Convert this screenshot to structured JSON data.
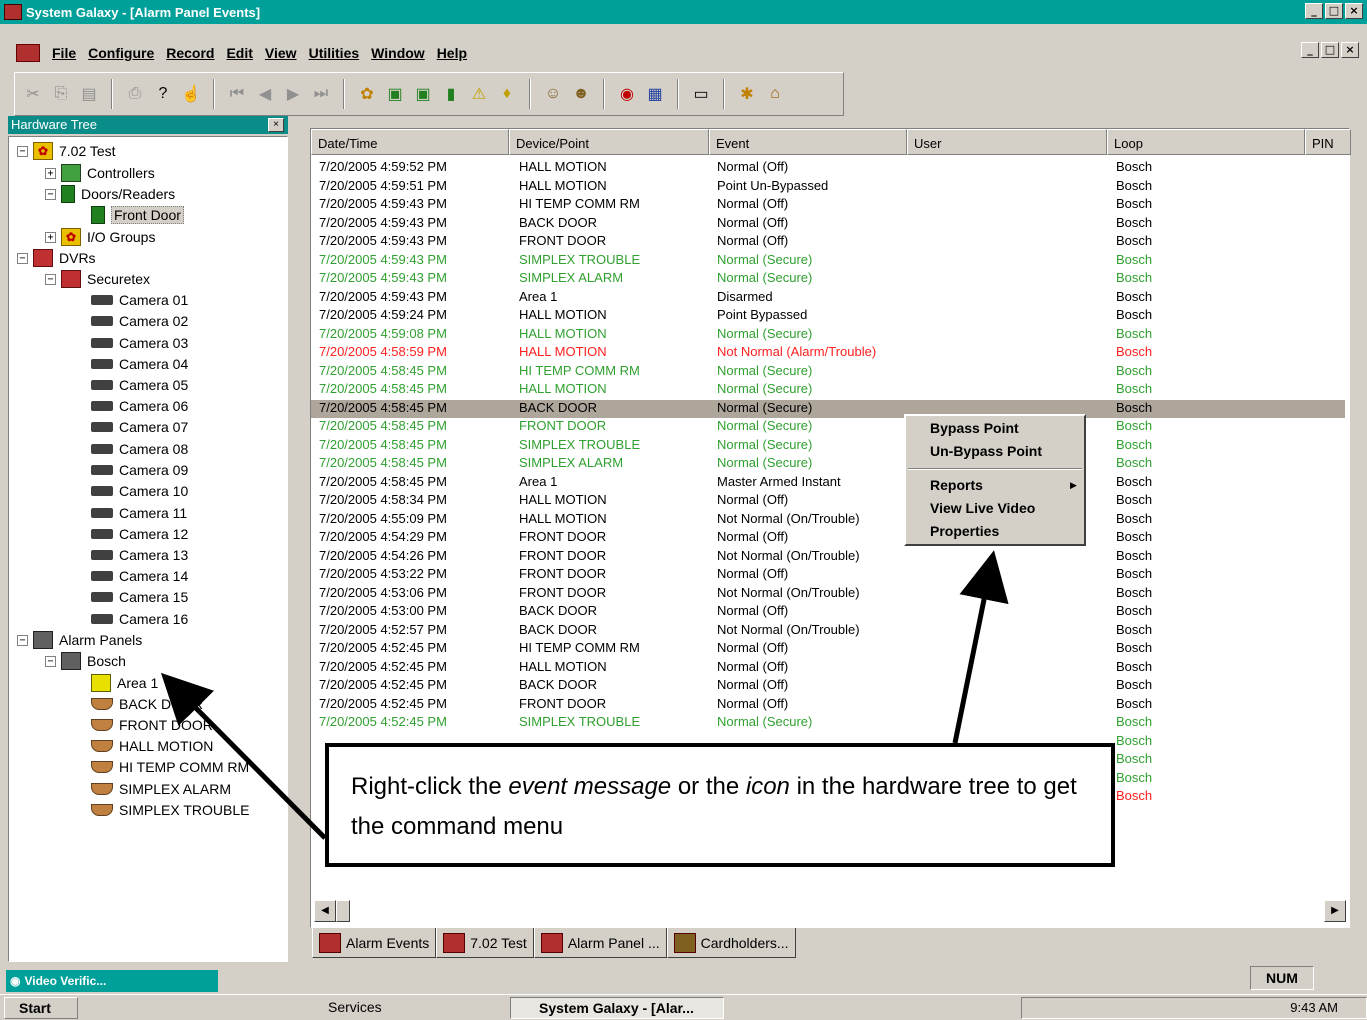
{
  "window": {
    "title": "System Galaxy - [Alarm Panel Events]",
    "controls": [
      "_",
      "□",
      "×"
    ]
  },
  "menu": [
    "File",
    "Configure",
    "Record",
    "Edit",
    "View",
    "Utilities",
    "Window",
    "Help"
  ],
  "tree": {
    "title": "Hardware Tree",
    "close": "×",
    "nodes": {
      "root": "7.02 Test",
      "controllers": "Controllers",
      "doors_readers": "Doors/Readers",
      "front_door": "Front Door",
      "io_groups": "I/O Groups",
      "dvrs": "DVRs",
      "securetex": "Securetex",
      "cameras": [
        "Camera 01",
        "Camera 02",
        "Camera 03",
        "Camera 04",
        "Camera 05",
        "Camera 06",
        "Camera 07",
        "Camera 08",
        "Camera 09",
        "Camera 10",
        "Camera 11",
        "Camera 12",
        "Camera 13",
        "Camera 14",
        "Camera 15",
        "Camera 16"
      ],
      "alarm_panels": "Alarm Panels",
      "bosch": "Bosch",
      "panel_points": [
        "Area 1",
        "BACK DOOR",
        "FRONT DOOR",
        "HALL MOTION",
        "HI TEMP COMM RM",
        "SIMPLEX ALARM",
        "SIMPLEX TROUBLE"
      ]
    }
  },
  "list": {
    "columns": [
      "Date/Time",
      "Device/Point",
      "Event",
      "User",
      "Loop",
      "PIN"
    ],
    "rows": [
      {
        "time": "7/20/2005 4:59:52 PM",
        "device": "HALL MOTION",
        "event": "Normal (Off)",
        "loop": "Bosch",
        "status": "normal"
      },
      {
        "time": "7/20/2005 4:59:51 PM",
        "device": "HALL MOTION",
        "event": "Point Un-Bypassed",
        "loop": "Bosch",
        "status": "normal"
      },
      {
        "time": "7/20/2005 4:59:43 PM",
        "device": "HI TEMP COMM RM",
        "event": "Normal (Off)",
        "loop": "Bosch",
        "status": "normal"
      },
      {
        "time": "7/20/2005 4:59:43 PM",
        "device": "BACK DOOR",
        "event": "Normal (Off)",
        "loop": "Bosch",
        "status": "normal"
      },
      {
        "time": "7/20/2005 4:59:43 PM",
        "device": "FRONT DOOR",
        "event": "Normal (Off)",
        "loop": "Bosch",
        "status": "normal"
      },
      {
        "time": "7/20/2005 4:59:43 PM",
        "device": "SIMPLEX TROUBLE",
        "event": "Normal (Secure)",
        "loop": "Bosch",
        "status": "green"
      },
      {
        "time": "7/20/2005 4:59:43 PM",
        "device": "SIMPLEX ALARM",
        "event": "Normal (Secure)",
        "loop": "Bosch",
        "status": "green"
      },
      {
        "time": "7/20/2005 4:59:43 PM",
        "device": "Area 1",
        "event": "Disarmed",
        "loop": "Bosch",
        "status": "normal"
      },
      {
        "time": "7/20/2005 4:59:24 PM",
        "device": "HALL MOTION",
        "event": "Point Bypassed",
        "loop": "Bosch",
        "status": "normal"
      },
      {
        "time": "7/20/2005 4:59:08 PM",
        "device": "HALL MOTION",
        "event": "Normal (Secure)",
        "loop": "Bosch",
        "status": "green"
      },
      {
        "time": "7/20/2005 4:58:59 PM",
        "device": "HALL MOTION",
        "event": "Not Normal (Alarm/Trouble)",
        "loop": "Bosch",
        "status": "red"
      },
      {
        "time": "7/20/2005 4:58:45 PM",
        "device": "HI TEMP COMM RM",
        "event": "Normal (Secure)",
        "loop": "Bosch",
        "status": "green"
      },
      {
        "time": "7/20/2005 4:58:45 PM",
        "device": "HALL MOTION",
        "event": "Normal (Secure)",
        "loop": "Bosch",
        "status": "green"
      },
      {
        "time": "7/20/2005 4:58:45 PM",
        "device": "BACK DOOR",
        "event": "Normal (Secure)",
        "loop": "Bosch",
        "status": "selected"
      },
      {
        "time": "7/20/2005 4:58:45 PM",
        "device": "FRONT DOOR",
        "event": "Normal (Secure)",
        "loop": "Bosch",
        "status": "green"
      },
      {
        "time": "7/20/2005 4:58:45 PM",
        "device": "SIMPLEX TROUBLE",
        "event": "Normal (Secure)",
        "loop": "Bosch",
        "status": "green"
      },
      {
        "time": "7/20/2005 4:58:45 PM",
        "device": "SIMPLEX ALARM",
        "event": "Normal (Secure)",
        "loop": "Bosch",
        "status": "green"
      },
      {
        "time": "7/20/2005 4:58:45 PM",
        "device": "Area 1",
        "event": "Master Armed Instant",
        "loop": "Bosch",
        "status": "normal"
      },
      {
        "time": "7/20/2005 4:58:34 PM",
        "device": "HALL MOTION",
        "event": "Normal (Off)",
        "loop": "Bosch",
        "status": "normal"
      },
      {
        "time": "7/20/2005 4:55:09 PM",
        "device": "HALL MOTION",
        "event": "Not Normal (On/Trouble)",
        "loop": "Bosch",
        "status": "normal"
      },
      {
        "time": "7/20/2005 4:54:29 PM",
        "device": "FRONT DOOR",
        "event": "Normal (Off)",
        "loop": "Bosch",
        "status": "normal"
      },
      {
        "time": "7/20/2005 4:54:26 PM",
        "device": "FRONT DOOR",
        "event": "Not Normal (On/Trouble)",
        "loop": "Bosch",
        "status": "normal"
      },
      {
        "time": "7/20/2005 4:53:22 PM",
        "device": "FRONT DOOR",
        "event": "Normal (Off)",
        "loop": "Bosch",
        "status": "normal"
      },
      {
        "time": "7/20/2005 4:53:06 PM",
        "device": "FRONT DOOR",
        "event": "Not Normal (On/Trouble)",
        "loop": "Bosch",
        "status": "normal"
      },
      {
        "time": "7/20/2005 4:53:00 PM",
        "device": "BACK DOOR",
        "event": "Normal (Off)",
        "loop": "Bosch",
        "status": "normal"
      },
      {
        "time": "7/20/2005 4:52:57 PM",
        "device": "BACK DOOR",
        "event": "Not Normal (On/Trouble)",
        "loop": "Bosch",
        "status": "normal"
      },
      {
        "time": "7/20/2005 4:52:45 PM",
        "device": "HI TEMP COMM RM",
        "event": "Normal (Off)",
        "loop": "Bosch",
        "status": "normal"
      },
      {
        "time": "7/20/2005 4:52:45 PM",
        "device": "HALL MOTION",
        "event": "Normal (Off)",
        "loop": "Bosch",
        "status": "normal"
      },
      {
        "time": "7/20/2005 4:52:45 PM",
        "device": "BACK DOOR",
        "event": "Normal (Off)",
        "loop": "Bosch",
        "status": "normal"
      },
      {
        "time": "7/20/2005 4:52:45 PM",
        "device": "FRONT DOOR",
        "event": "Normal (Off)",
        "loop": "Bosch",
        "status": "normal"
      },
      {
        "time": "7/20/2005 4:52:45 PM",
        "device": "SIMPLEX TROUBLE",
        "event": "Normal (Secure)",
        "loop": "Bosch",
        "status": "green"
      },
      {
        "time": "",
        "device": "",
        "event": "",
        "loop": "Bosch",
        "status": "green"
      },
      {
        "time": "",
        "device": "",
        "event": "",
        "loop": "Bosch",
        "status": "green"
      },
      {
        "time": "",
        "device": "",
        "event": "",
        "loop": "Bosch",
        "status": "green"
      },
      {
        "time": "",
        "device": "",
        "event": "",
        "loop": "Bosch",
        "status": "red"
      }
    ]
  },
  "context_menu": [
    "Bypass Point",
    "Un-Bypass Point",
    "Reports",
    "View Live Video",
    "Properties"
  ],
  "callout": {
    "part1": "Right-click the ",
    "em1": "event message",
    "part2": " or the ",
    "em2": "icon",
    "part3": " in the hardware tree to get the command menu"
  },
  "tabs": [
    "Alarm Events",
    "7.02 Test",
    "Alarm Panel ...",
    "Cardholders..."
  ],
  "status": {
    "minimized_window": "Video Verific...",
    "num": "NUM"
  },
  "taskbar": {
    "start": "Start",
    "services": "Services",
    "active": "System Galaxy - [Alar...",
    "clock": "9:43 AM"
  },
  "colors": {
    "titlebar": "#00a09a",
    "green_event": "#30a030",
    "red_event": "#ff2020",
    "selected_row": "#aea69a"
  }
}
